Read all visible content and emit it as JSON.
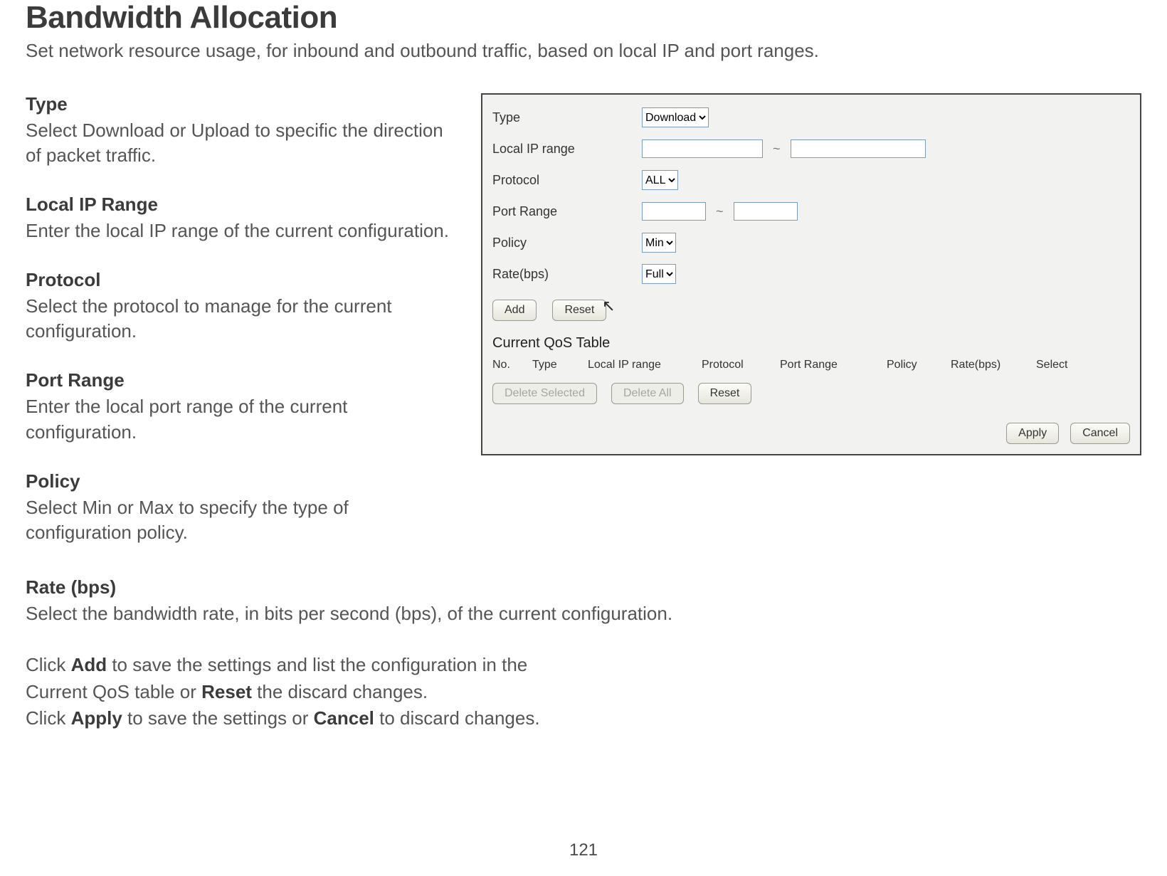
{
  "page": {
    "title": "Bandwidth Allocation",
    "subtitle": "Set network resource usage, for inbound and outbound traffic, based on local IP and port ranges.",
    "page_number": "121"
  },
  "fields": {
    "type": {
      "label": "Type",
      "desc": "Select Download or Upload to specific the direction of packet traffic."
    },
    "local_ip": {
      "label": "Local IP Range",
      "desc": "Enter the local IP range of the current configuration."
    },
    "protocol": {
      "label": "Protocol",
      "desc": "Select the protocol to manage for the current configuration."
    },
    "port_range": {
      "label": "Port Range",
      "desc": "Enter the local port range of the current configuration."
    },
    "policy": {
      "label": "Policy",
      "desc": "Select Min or Max to specify the type of configuration policy."
    },
    "rate": {
      "label": "Rate (bps)",
      "desc": "Select the bandwidth rate, in bits per second (bps), of the current configuration."
    }
  },
  "notes": {
    "line1a": "Click ",
    "line1b": "Add",
    "line1c": " to save the settings and list the configuration in the",
    "line2a": "Current QoS table or ",
    "line2b": "Reset",
    "line2c": " the discard changes.",
    "line3a": "Click ",
    "line3b": "Apply",
    "line3c": " to save the settings or ",
    "line3d": "Cancel",
    "line3e": " to discard changes."
  },
  "panel": {
    "labels": {
      "type": "Type",
      "local_ip": "Local IP range",
      "protocol": "Protocol",
      "port_range": "Port Range",
      "policy": "Policy",
      "rate": "Rate(bps)"
    },
    "values": {
      "type_selected": "Download",
      "protocol_selected": "ALL",
      "policy_selected": "Min",
      "rate_selected": "Full",
      "ip_start": "",
      "ip_end": "",
      "port_start": "",
      "port_end": ""
    },
    "range_sep": "~",
    "buttons": {
      "add": "Add",
      "reset": "Reset",
      "delete_selected": "Delete Selected",
      "delete_all": "Delete All",
      "reset2": "Reset",
      "apply": "Apply",
      "cancel": "Cancel"
    },
    "qos": {
      "title": "Current QoS Table",
      "columns": {
        "no": "No.",
        "type": "Type",
        "local_ip": "Local IP range",
        "protocol": "Protocol",
        "port_range": "Port Range",
        "policy": "Policy",
        "rate": "Rate(bps)",
        "select": "Select"
      }
    }
  }
}
